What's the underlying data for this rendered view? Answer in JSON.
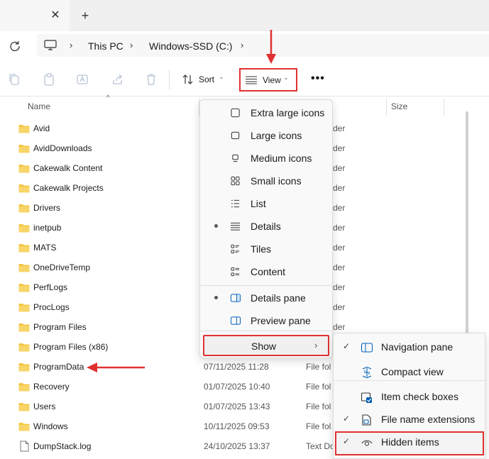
{
  "tab": {
    "close_glyph": "✕",
    "new_tab_glyph": "+"
  },
  "address": {
    "separator": "›",
    "crumbs": [
      "This PC",
      "Windows-SSD (C:)"
    ]
  },
  "toolbar": {
    "sort_label": "Sort",
    "view_label": "View",
    "more_label": "•••",
    "chevron": "⌄"
  },
  "columns": {
    "name": "Name",
    "size": "Size",
    "sort_caret": "^"
  },
  "files": [
    {
      "name": "Avid",
      "date": "",
      "type": "der",
      "icon": "folder-icon"
    },
    {
      "name": "AvidDownloads",
      "date": "",
      "type": "der",
      "icon": "folder-icon"
    },
    {
      "name": "Cakewalk Content",
      "date": "",
      "type": "der",
      "icon": "folder-icon"
    },
    {
      "name": "Cakewalk Projects",
      "date": "",
      "type": "der",
      "icon": "folder-icon"
    },
    {
      "name": "Drivers",
      "date": "",
      "type": "der",
      "icon": "folder-icon"
    },
    {
      "name": "inetpub",
      "date": "",
      "type": "der",
      "icon": "folder-icon"
    },
    {
      "name": "MATS",
      "date": "",
      "type": "der",
      "icon": "folder-icon"
    },
    {
      "name": "OneDriveTemp",
      "date": "",
      "type": "der",
      "icon": "folder-icon"
    },
    {
      "name": "PerfLogs",
      "date": "",
      "type": "der",
      "icon": "folder-icon"
    },
    {
      "name": "ProcLogs",
      "date": "",
      "type": "der",
      "icon": "folder-icon"
    },
    {
      "name": "Program Files",
      "date": "",
      "type": "der",
      "icon": "folder-icon"
    },
    {
      "name": "Program Files (x86)",
      "date": "",
      "type": "",
      "icon": "folder-icon"
    },
    {
      "name": "ProgramData",
      "date": "07/11/2025 11:28",
      "type": "File fol",
      "icon": "folder-icon"
    },
    {
      "name": "Recovery",
      "date": "01/07/2025 10:40",
      "type": "File fol",
      "icon": "folder-icon"
    },
    {
      "name": "Users",
      "date": "01/07/2025 13:43",
      "type": "File fol",
      "icon": "folder-icon"
    },
    {
      "name": "Windows",
      "date": "10/11/2025 09:53",
      "type": "File fol",
      "icon": "folder-icon"
    },
    {
      "name": "DumpStack.log",
      "date": "24/10/2025 13:37",
      "type": "Text Do",
      "icon": "file-icon"
    }
  ],
  "view_menu": {
    "items": [
      {
        "label": "Extra large icons",
        "selected": false,
        "icon": "extra-large-icons-icon"
      },
      {
        "label": "Large icons",
        "selected": false,
        "icon": "large-icons-icon"
      },
      {
        "label": "Medium icons",
        "selected": false,
        "icon": "medium-icons-icon"
      },
      {
        "label": "Small icons",
        "selected": false,
        "icon": "small-icons-icon"
      },
      {
        "label": "List",
        "selected": false,
        "icon": "list-icon"
      },
      {
        "label": "Details",
        "selected": true,
        "icon": "details-icon"
      },
      {
        "label": "Tiles",
        "selected": false,
        "icon": "tiles-icon"
      },
      {
        "label": "Content",
        "selected": false,
        "icon": "content-icon"
      },
      {
        "label": "Details pane",
        "selected": true,
        "icon": "details-pane-icon"
      },
      {
        "label": "Preview pane",
        "selected": false,
        "icon": "preview-pane-icon"
      }
    ],
    "show_label": "Show",
    "show_chevron": "›"
  },
  "show_menu": {
    "items": [
      {
        "label": "Navigation pane",
        "checked": true,
        "icon": "navigation-pane-icon"
      },
      {
        "label": "Compact view",
        "checked": false,
        "icon": "compact-view-icon"
      },
      {
        "label": "Item check boxes",
        "checked": false,
        "icon": "item-check-boxes-icon"
      },
      {
        "label": "File name extensions",
        "checked": true,
        "icon": "file-extension-icon"
      },
      {
        "label": "Hidden items",
        "checked": true,
        "icon": "hidden-items-icon"
      }
    ],
    "check_glyph": "✓"
  },
  "colors": {
    "accent": "#005fb8",
    "folder": "#f4c542",
    "annotation": "#e03131"
  }
}
